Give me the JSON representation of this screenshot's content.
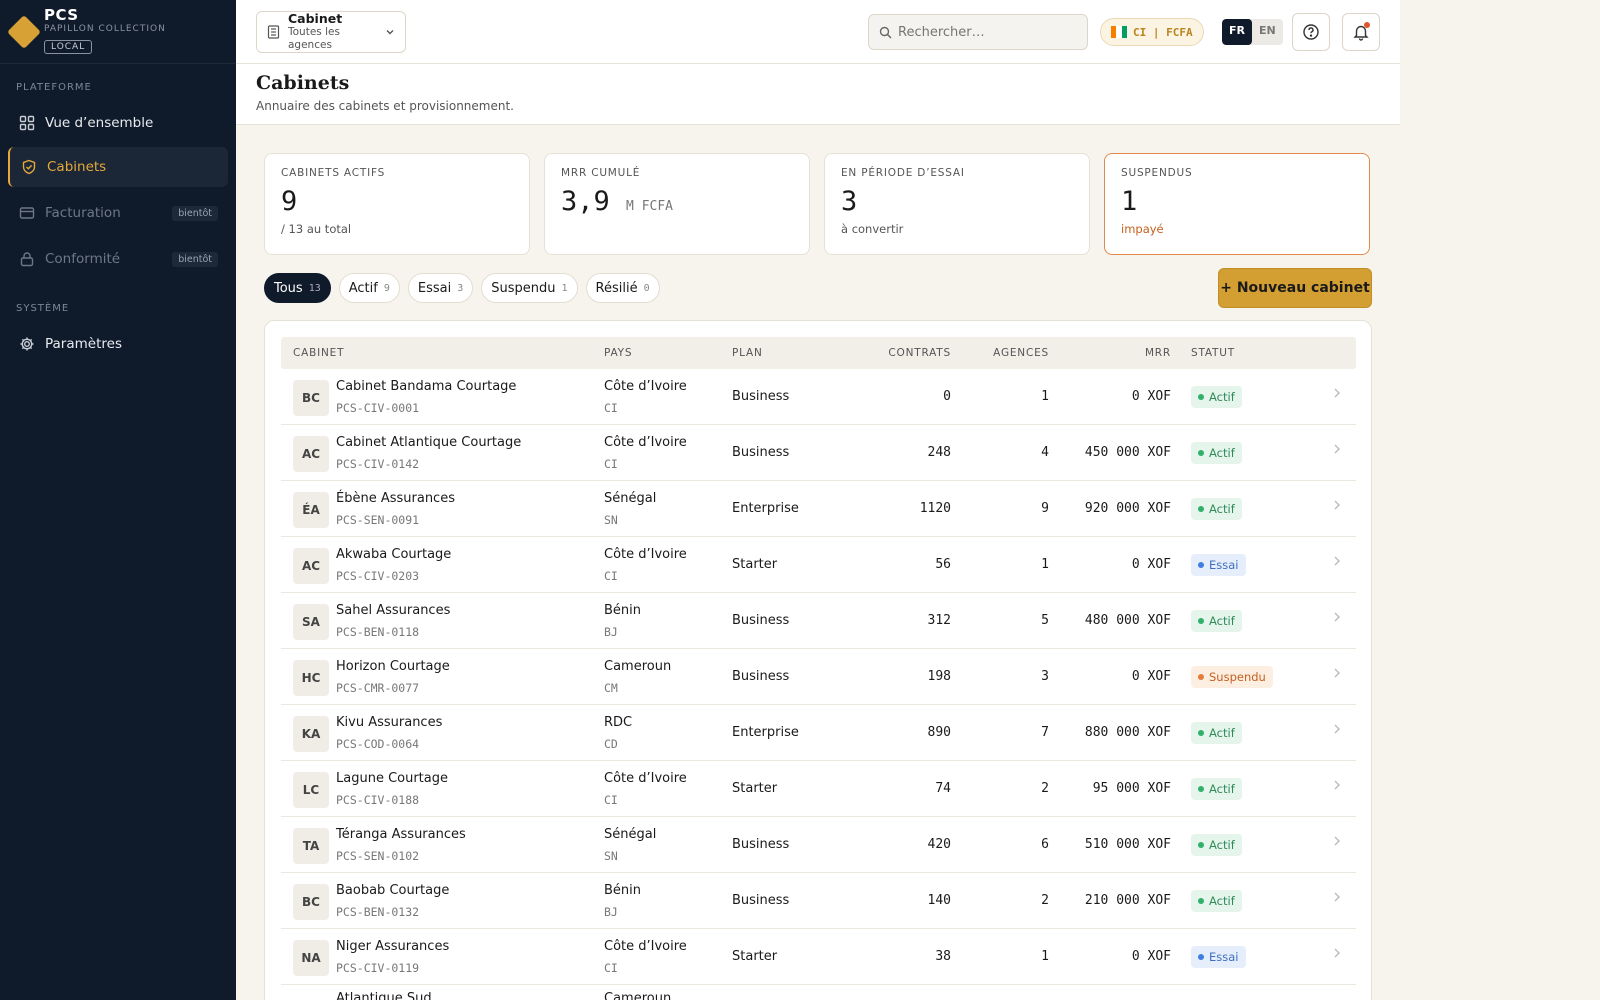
{
  "brand": {
    "name": "PCS",
    "sub": "PAPILLON COLLECTION",
    "badge": "LOCAL"
  },
  "sidebar": {
    "section_platform": "PLATEFORME",
    "section_system": "SYSTÈME",
    "items": [
      {
        "label": "Vue d’ensemble",
        "icon": "grid-icon"
      },
      {
        "label": "Cabinets",
        "icon": "shield-icon"
      },
      {
        "label": "Facturation",
        "icon": "card-icon",
        "soon": "bientôt"
      },
      {
        "label": "Conformité",
        "icon": "lock-icon",
        "soon": "bientôt"
      },
      {
        "label": "Paramètres",
        "icon": "gear-icon"
      }
    ]
  },
  "topbar": {
    "selector_title": "Cabinet",
    "selector_sub": "Toutes les agences",
    "search_placeholder": "Rechercher…",
    "country": "CI | FCFA",
    "lang_active": "FR",
    "lang_other": "EN"
  },
  "header": {
    "title": "Cabinets",
    "subtitle": "Annuaire des cabinets et provisionnement."
  },
  "stats": [
    {
      "label": "CABINETS ACTIFS",
      "value": "9",
      "unit": "",
      "note": "/ 13 au total"
    },
    {
      "label": "MRR CUMULÉ",
      "value": "3,9",
      "unit": "M FCFA",
      "note": ""
    },
    {
      "label": "EN PÉRIODE D’ESSAI",
      "value": "3",
      "unit": "",
      "note": "à convertir"
    },
    {
      "label": "SUSPENDUS",
      "value": "1",
      "unit": "",
      "note": "impayé"
    }
  ],
  "filters": [
    {
      "label": "Tous",
      "count": "13"
    },
    {
      "label": "Actif",
      "count": "9"
    },
    {
      "label": "Essai",
      "count": "3"
    },
    {
      "label": "Suspendu",
      "count": "1"
    },
    {
      "label": "Résilié",
      "count": "0"
    }
  ],
  "new_button": "+ Nouveau cabinet",
  "table": {
    "columns": [
      "CABINET",
      "PAYS",
      "PLAN",
      "CONTRATS",
      "AGENCES",
      "MRR",
      "STATUT"
    ],
    "rows": [
      {
        "initials": "BC",
        "name": "Cabinet Bandama Courtage",
        "code": "PCS-CIV-0001",
        "country": "Côte d’Ivoire",
        "cc": "CI",
        "plan": "Business",
        "contracts": "0",
        "agencies": "1",
        "mrr": "0 XOF",
        "status": "Actif",
        "kind": "actif"
      },
      {
        "initials": "AC",
        "name": "Cabinet Atlantique Courtage",
        "code": "PCS-CIV-0142",
        "country": "Côte d’Ivoire",
        "cc": "CI",
        "plan": "Business",
        "contracts": "248",
        "agencies": "4",
        "mrr": "450 000 XOF",
        "status": "Actif",
        "kind": "actif"
      },
      {
        "initials": "ÉA",
        "name": "Ébène Assurances",
        "code": "PCS-SEN-0091",
        "country": "Sénégal",
        "cc": "SN",
        "plan": "Enterprise",
        "contracts": "1120",
        "agencies": "9",
        "mrr": "920 000 XOF",
        "status": "Actif",
        "kind": "actif"
      },
      {
        "initials": "AC",
        "name": "Akwaba Courtage",
        "code": "PCS-CIV-0203",
        "country": "Côte d’Ivoire",
        "cc": "CI",
        "plan": "Starter",
        "contracts": "56",
        "agencies": "1",
        "mrr": "0 XOF",
        "status": "Essai",
        "kind": "essai"
      },
      {
        "initials": "SA",
        "name": "Sahel Assurances",
        "code": "PCS-BEN-0118",
        "country": "Bénin",
        "cc": "BJ",
        "plan": "Business",
        "contracts": "312",
        "agencies": "5",
        "mrr": "480 000 XOF",
        "status": "Actif",
        "kind": "actif"
      },
      {
        "initials": "HC",
        "name": "Horizon Courtage",
        "code": "PCS-CMR-0077",
        "country": "Cameroun",
        "cc": "CM",
        "plan": "Business",
        "contracts": "198",
        "agencies": "3",
        "mrr": "0 XOF",
        "status": "Suspendu",
        "kind": "susp"
      },
      {
        "initials": "KA",
        "name": "Kivu Assurances",
        "code": "PCS-COD-0064",
        "country": "RDC",
        "cc": "CD",
        "plan": "Enterprise",
        "contracts": "890",
        "agencies": "7",
        "mrr": "880 000 XOF",
        "status": "Actif",
        "kind": "actif"
      },
      {
        "initials": "LC",
        "name": "Lagune Courtage",
        "code": "PCS-CIV-0188",
        "country": "Côte d’Ivoire",
        "cc": "CI",
        "plan": "Starter",
        "contracts": "74",
        "agencies": "2",
        "mrr": "95 000 XOF",
        "status": "Actif",
        "kind": "actif"
      },
      {
        "initials": "TA",
        "name": "Téranga Assurances",
        "code": "PCS-SEN-0102",
        "country": "Sénégal",
        "cc": "SN",
        "plan": "Business",
        "contracts": "420",
        "agencies": "6",
        "mrr": "510 000 XOF",
        "status": "Actif",
        "kind": "actif"
      },
      {
        "initials": "BC",
        "name": "Baobab Courtage",
        "code": "PCS-BEN-0132",
        "country": "Bénin",
        "cc": "BJ",
        "plan": "Business",
        "contracts": "140",
        "agencies": "2",
        "mrr": "210 000 XOF",
        "status": "Actif",
        "kind": "actif"
      },
      {
        "initials": "NA",
        "name": "Niger Assurances",
        "code": "PCS-CIV-0119",
        "country": "Côte d’Ivoire",
        "cc": "CI",
        "plan": "Starter",
        "contracts": "38",
        "agencies": "1",
        "mrr": "0 XOF",
        "status": "Essai",
        "kind": "essai"
      }
    ],
    "partial_row": {
      "name": "Atlantique Sud",
      "country": "Cameroun"
    }
  },
  "colors": {
    "accent": "#e4a93a",
    "sidebar_bg": "#0f1a2a",
    "button": "#d39f32",
    "warn_border": "#e28a4b"
  }
}
